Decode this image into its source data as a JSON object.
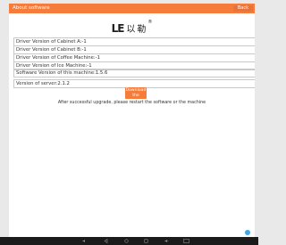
{
  "header": {
    "title": "About software",
    "back_label": "Back"
  },
  "logo": {
    "mark": "LE",
    "text": "以勒",
    "reg": "®"
  },
  "versions": [
    "Driver Version of Cabinet A:-1",
    "Driver Version of Cabinet B:-1",
    "Driver Version of Coffee Machine:-1",
    "Driver Version of Ice Machine:-1"
  ],
  "software_version": "Software Version of this machine:1.5.6",
  "server_version": "Version of server:2.1.2",
  "download_button": "Download the",
  "note": "After successful upgrade, please restart the software or the machine",
  "navbar": {
    "icons": [
      "volume-down-icon",
      "back-icon",
      "home-icon",
      "recents-icon",
      "volume-up-icon",
      "screenshot-icon"
    ]
  },
  "colors": {
    "accent": "#f57c3a",
    "fab": "#3aa7e6"
  }
}
